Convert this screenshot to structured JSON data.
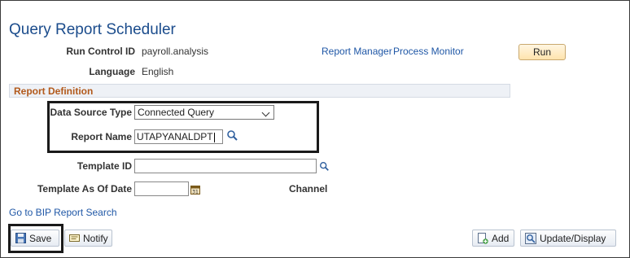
{
  "page": {
    "title": "Query Report Scheduler"
  },
  "run_control": {
    "label": "Run Control ID",
    "value": "payroll.analysis"
  },
  "language": {
    "label": "Language",
    "value": "English"
  },
  "links": {
    "report_manager": "Report Manager",
    "process_monitor": "Process Monitor",
    "bip_search": "Go to BIP Report Search"
  },
  "run_button": "Run",
  "report_definition": {
    "section_title": "Report Definition",
    "data_source_label": "Data Source Type",
    "data_source_value": "Connected Query",
    "report_name_label": "Report Name",
    "report_name_value": "UTAPYANALDPT",
    "template_id_label": "Template ID",
    "template_id_value": "",
    "template_date_label": "Template As Of Date",
    "template_date_value": "",
    "channel_label": "Channel"
  },
  "toolbar": {
    "save": "Save",
    "notify": "Notify",
    "add": "Add",
    "update_display": "Update/Display"
  },
  "icons": {
    "lookup": "magnifier-icon",
    "calendar": "calendar-icon",
    "save": "floppy-disk-icon",
    "notify": "notify-icon",
    "add": "add-document-icon",
    "update": "update-display-icon"
  }
}
